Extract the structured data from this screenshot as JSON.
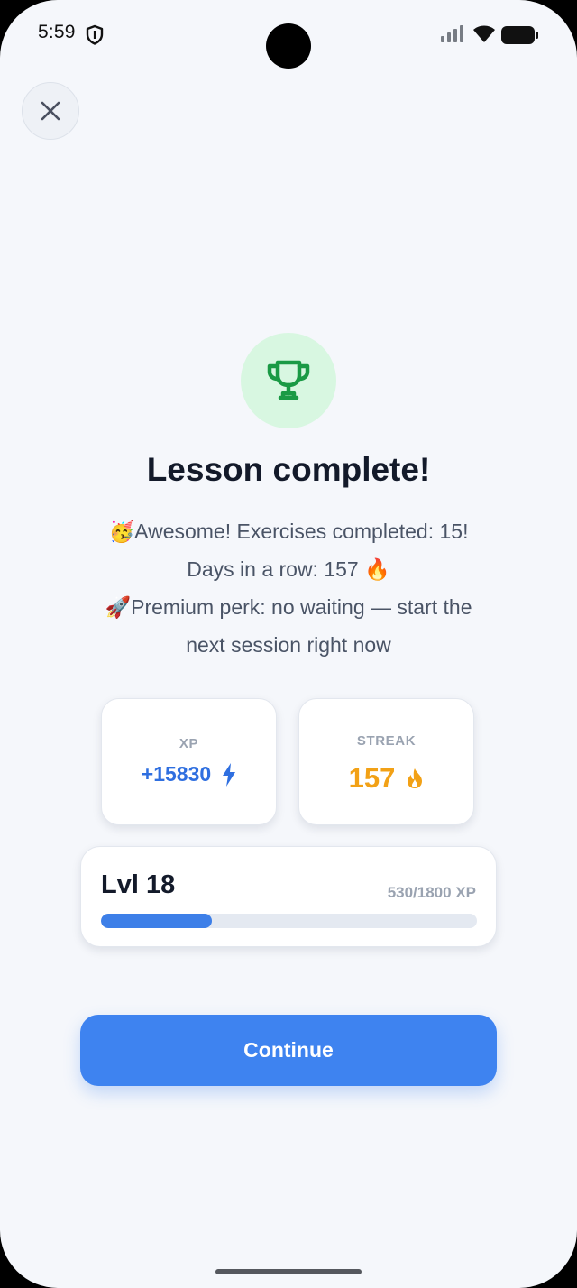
{
  "status_bar": {
    "time": "5:59"
  },
  "header": {
    "close_icon": "close-icon"
  },
  "hero": {
    "icon": "trophy-icon",
    "icon_color": "#1a9a45",
    "title": "Lesson complete!",
    "lines": [
      "🥳Awesome! Exercises completed: 15!",
      "Days in a row: 157 🔥",
      "🚀Premium perk: no waiting — start the",
      "next session right now"
    ]
  },
  "stats": {
    "xp": {
      "label": "XP",
      "value": "+15830",
      "icon": "lightning-icon",
      "color": "#2f6fe0"
    },
    "streak": {
      "label": "STREAK",
      "value": "157",
      "icon": "flame-icon",
      "color": "#f2a116"
    }
  },
  "level": {
    "title": "Lvl 18",
    "xp_text": "530/1800 XP",
    "progress_fraction": 0.2944,
    "progress_color": "#3d7fe8"
  },
  "actions": {
    "continue_label": "Continue",
    "continue_color": "#3e83f0"
  }
}
